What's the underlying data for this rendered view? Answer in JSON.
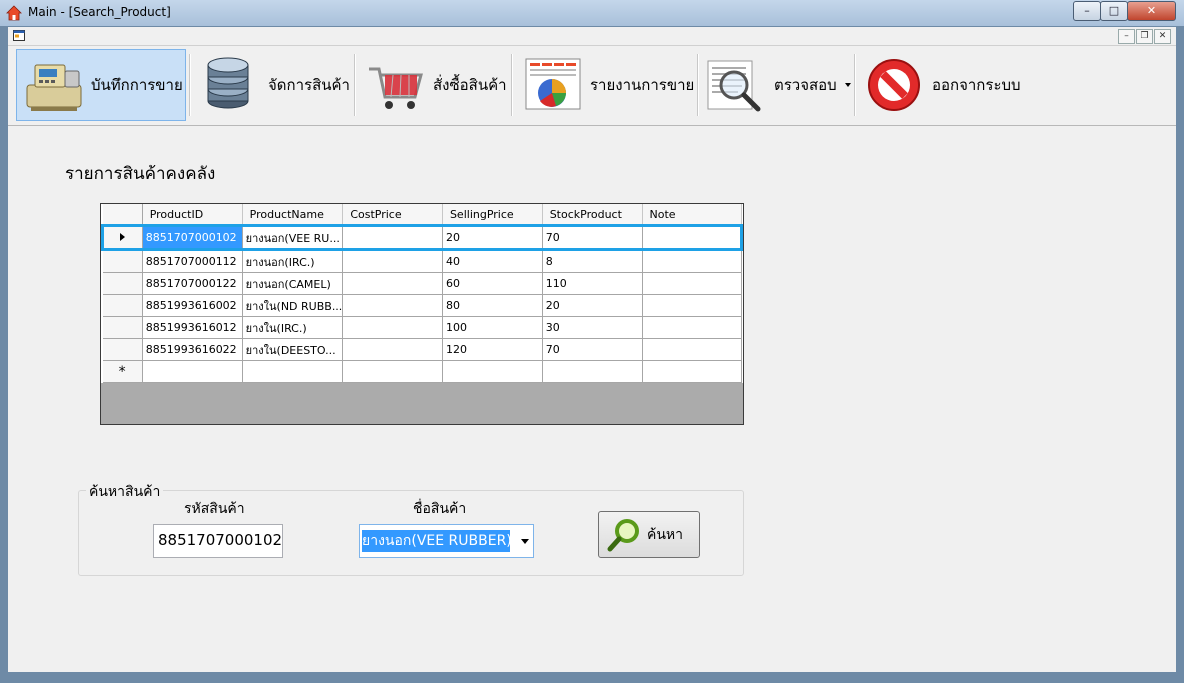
{
  "window": {
    "title": "Main - [Search_Product]",
    "minimize": "–",
    "maximize": "□",
    "close": "✕"
  },
  "mdi": {
    "minimize": "–",
    "restore": "❐",
    "close": "✕"
  },
  "toolbar": {
    "items": [
      {
        "label": "บันทึกการขาย",
        "icon": "cash-register-icon",
        "active": true
      },
      {
        "label": "จัดการสินค้า",
        "icon": "database-icon"
      },
      {
        "label": "สั่งซื้อสินค้า",
        "icon": "shopping-cart-icon"
      },
      {
        "label": "รายงานการขาย",
        "icon": "report-chart-icon"
      },
      {
        "label": "ตรวจสอบ",
        "icon": "magnifier-document-icon",
        "dropdown": true
      },
      {
        "label": "ออกจากระบบ",
        "icon": "logout-stop-icon"
      }
    ]
  },
  "section": {
    "title": "รายการสินค้าคงคลัง"
  },
  "grid": {
    "columns": [
      "ProductID",
      "ProductName",
      "CostPrice",
      "SellingPrice",
      "StockProduct",
      "Note"
    ],
    "rows": [
      [
        "8851707000102",
        "ยางนอก(VEE RU...",
        "",
        "20",
        "70",
        ""
      ],
      [
        "8851707000112",
        "ยางนอก(IRC.)",
        "",
        "40",
        "8",
        ""
      ],
      [
        "8851707000122",
        "ยางนอก(CAMEL)",
        "",
        "60",
        "110",
        ""
      ],
      [
        "8851993616002",
        "ยางใน(ND RUBB...",
        "",
        "80",
        "20",
        ""
      ],
      [
        "8851993616012",
        "ยางใน(IRC.)",
        "",
        "100",
        "30",
        ""
      ],
      [
        "8851993616022",
        "ยางใน(DEESTO...",
        "",
        "120",
        "70",
        ""
      ]
    ],
    "new_row_marker": "*",
    "selected_row": 0
  },
  "search": {
    "group_title": "ค้นหาสินค้า",
    "code_label": "รหัสสินค้า",
    "code_value": "8851707000102",
    "name_label": "ชื่อสินค้า",
    "name_value": "ยางนอก(VEE RUBBER)",
    "button_label": "ค้นหา"
  },
  "colors": {
    "selection_border": "#1ea1e6",
    "selection_fill": "#3399ff",
    "toolbar_active": "#c9e0f7"
  }
}
